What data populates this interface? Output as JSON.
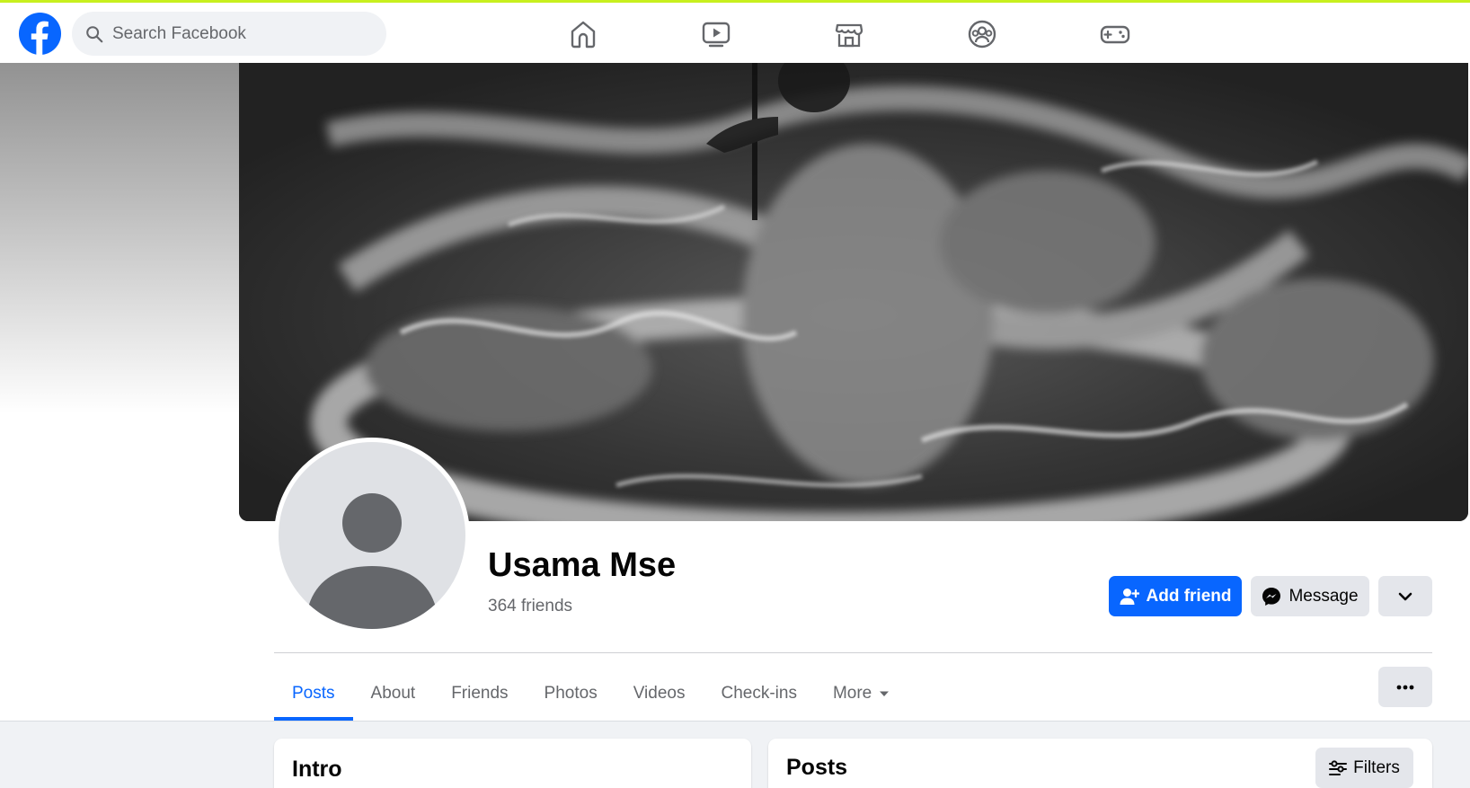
{
  "header": {
    "logo_icon": "facebook-logo-icon",
    "search": {
      "placeholder": "Search Facebook",
      "icon": "search-icon"
    },
    "nav_icons": [
      "home-icon",
      "video-icon",
      "marketplace-icon",
      "groups-icon",
      "gaming-icon"
    ],
    "accent_color": "#c8f01e"
  },
  "profile": {
    "name": "Usama Mse",
    "friends_count": "364 friends",
    "avatar_icon": "default-avatar-icon",
    "cover_description": "black-and-white-wave-cover"
  },
  "actions": {
    "add_friend_label": "Add friend",
    "message_label": "Message",
    "dropdown_icon": "chevron-down-icon",
    "brand_color": "#0866ff"
  },
  "tabs": [
    {
      "label": "Posts",
      "active": true
    },
    {
      "label": "About",
      "active": false
    },
    {
      "label": "Friends",
      "active": false
    },
    {
      "label": "Photos",
      "active": false
    },
    {
      "label": "Videos",
      "active": false
    },
    {
      "label": "Check-ins",
      "active": false
    },
    {
      "label": "More",
      "active": false
    }
  ],
  "sections": {
    "intro_title": "Intro",
    "posts_title": "Posts",
    "filters_label": "Filters"
  }
}
